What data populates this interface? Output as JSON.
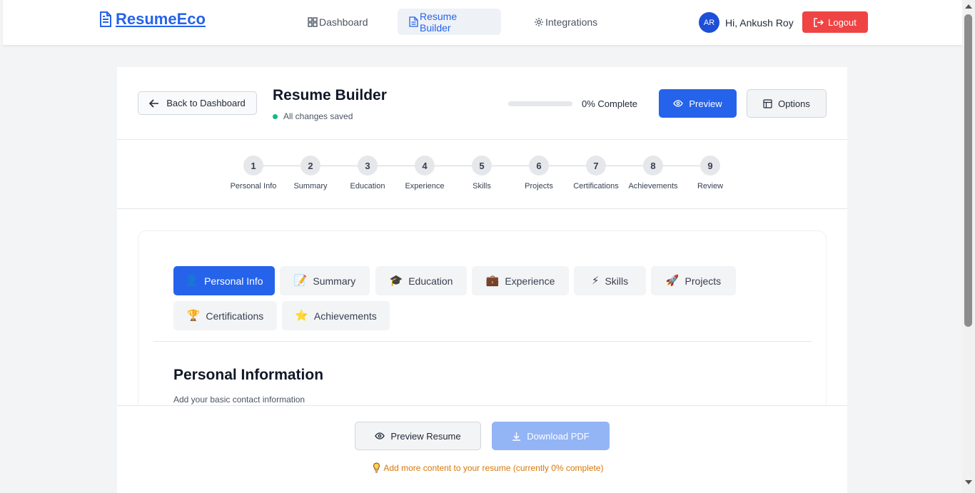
{
  "brand": {
    "name": "ResumeEco"
  },
  "nav": {
    "items": [
      {
        "label": "Dashboard",
        "icon": "dashboard-grid-icon"
      },
      {
        "label": "Resume Builder",
        "icon": "document-icon",
        "active": true
      },
      {
        "label": "Integrations",
        "icon": "gear-icon"
      }
    ]
  },
  "user": {
    "initials": "AR",
    "greeting": "Hi, Ankush Roy",
    "logout_label": "Logout"
  },
  "header": {
    "back_label": "Back to Dashboard",
    "title": "Resume Builder",
    "save_status": "All changes saved",
    "progress_text": "0% Complete",
    "progress_percent": 0,
    "preview_label": "Preview",
    "options_label": "Options"
  },
  "steps": [
    {
      "num": "1",
      "label": "Personal Info"
    },
    {
      "num": "2",
      "label": "Summary"
    },
    {
      "num": "3",
      "label": "Education"
    },
    {
      "num": "4",
      "label": "Experience"
    },
    {
      "num": "5",
      "label": "Skills"
    },
    {
      "num": "6",
      "label": "Projects"
    },
    {
      "num": "7",
      "label": "Certifications"
    },
    {
      "num": "8",
      "label": "Achievements"
    },
    {
      "num": "9",
      "label": "Review"
    }
  ],
  "tabs": [
    {
      "label": "Personal Info",
      "emoji": "👤",
      "active": true
    },
    {
      "label": "Summary",
      "emoji": "📝"
    },
    {
      "label": "Education",
      "emoji": "🎓"
    },
    {
      "label": "Experience",
      "emoji": "💼"
    },
    {
      "label": "Skills",
      "emoji": "⚡"
    },
    {
      "label": "Projects",
      "emoji": "🚀"
    },
    {
      "label": "Certifications",
      "emoji": "🏆"
    },
    {
      "label": "Achievements",
      "emoji": "⭐"
    }
  ],
  "section": {
    "title": "Personal Information",
    "subtitle": "Add your basic contact information"
  },
  "footer": {
    "preview_resume_label": "Preview Resume",
    "download_pdf_label": "Download PDF",
    "hint": "Add more content to your resume (currently 0% complete)"
  },
  "colors": {
    "primary": "#2563eb",
    "danger": "#ef4444",
    "success": "#10b981",
    "warning": "#d97706"
  }
}
